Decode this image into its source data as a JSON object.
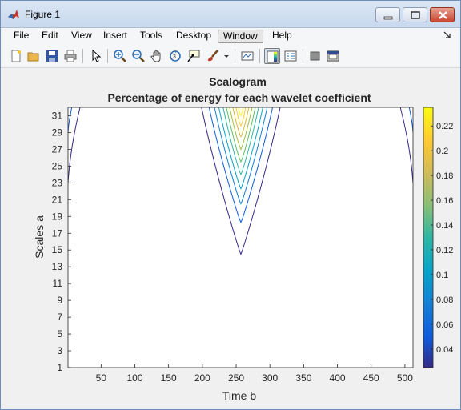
{
  "window": {
    "title": "Figure 1"
  },
  "menu": [
    "File",
    "Edit",
    "View",
    "Insert",
    "Tools",
    "Desktop",
    "Window",
    "Help"
  ],
  "menu_active": "Window",
  "toolbar": {
    "icons": [
      "new-figure-icon",
      "open-file-icon",
      "save-icon",
      "print-icon",
      "edit-plot-pointer-icon",
      "zoom-in-icon",
      "zoom-out-icon",
      "pan-hand-icon",
      "rotate-3d-icon",
      "data-cursor-icon",
      "brush-icon",
      "brush-dropdown-icon",
      "link-plot-icon",
      "insert-colorbar-icon",
      "insert-legend-icon",
      "hide-plot-tools-icon",
      "show-plot-tools-icon"
    ]
  },
  "chart_data": {
    "type": "contour",
    "title": "Scalogram",
    "subtitle": "Percentage of energy for each wavelet coefficient",
    "xlabel": "Time b",
    "ylabel": "Scales a",
    "xlim": [
      1,
      512
    ],
    "ylim": [
      1,
      32
    ],
    "xticks": [
      "50",
      "100",
      "150",
      "200",
      "250",
      "300",
      "350",
      "400",
      "450",
      "500"
    ],
    "yticks": [
      "1",
      "3",
      "5",
      "7",
      "9",
      "11",
      "13",
      "15",
      "17",
      "19",
      "21",
      "23",
      "25",
      "27",
      "29",
      "31"
    ],
    "colorbar": {
      "ticks": [
        "0.04",
        "0.06",
        "0.08",
        "0.1",
        "0.12",
        "0.14",
        "0.16",
        "0.18",
        "0.2",
        "0.22"
      ],
      "range": [
        0.025,
        0.235
      ],
      "colormap": "parula"
    },
    "contours": [
      {
        "level": 0.03,
        "color": "#352a87",
        "center_x": 257,
        "apex_y": 14.5,
        "top_half_width": 37
      },
      {
        "level": 0.06,
        "color": "#0f5cdd",
        "center_x": 257,
        "apex_y": 18.3,
        "top_half_width": 30
      },
      {
        "level": 0.08,
        "color": "#1481d6",
        "center_x": 257,
        "apex_y": 20.5,
        "top_half_width": 25
      },
      {
        "level": 0.1,
        "color": "#06a4ca",
        "center_x": 257,
        "apex_y": 22.3,
        "top_half_width": 21
      },
      {
        "level": 0.12,
        "color": "#2eb7a4",
        "center_x": 257,
        "apex_y": 24.0,
        "top_half_width": 17
      },
      {
        "level": 0.14,
        "color": "#5cc063",
        "center_x": 257,
        "apex_y": 25.5,
        "top_half_width": 14
      },
      {
        "level": 0.16,
        "color": "#a5be3f",
        "center_x": 257,
        "apex_y": 27.0,
        "top_half_width": 11
      },
      {
        "level": 0.18,
        "color": "#d9ba2f",
        "center_x": 257,
        "apex_y": 28.5,
        "top_half_width": 8
      },
      {
        "level": 0.2,
        "color": "#fcce2e",
        "center_x": 257,
        "apex_y": 29.8,
        "top_half_width": 5
      },
      {
        "level": 0.22,
        "color": "#f9fb0e",
        "center_x": 257,
        "apex_y": 31.0,
        "top_half_width": 3
      }
    ],
    "edge_contours": [
      {
        "side": "left",
        "level": 0.03,
        "color": "#352a87",
        "x_at_top": 20,
        "y_at_edge": 23
      },
      {
        "side": "left",
        "level": 0.06,
        "color": "#0f5cdd",
        "x_at_top": 7,
        "y_at_edge": 29
      },
      {
        "side": "right",
        "level": 0.03,
        "color": "#352a87",
        "x_at_top": 492,
        "y_at_edge": 23
      },
      {
        "side": "right",
        "level": 0.06,
        "color": "#0f5cdd",
        "x_at_top": 506,
        "y_at_edge": 29
      }
    ]
  }
}
